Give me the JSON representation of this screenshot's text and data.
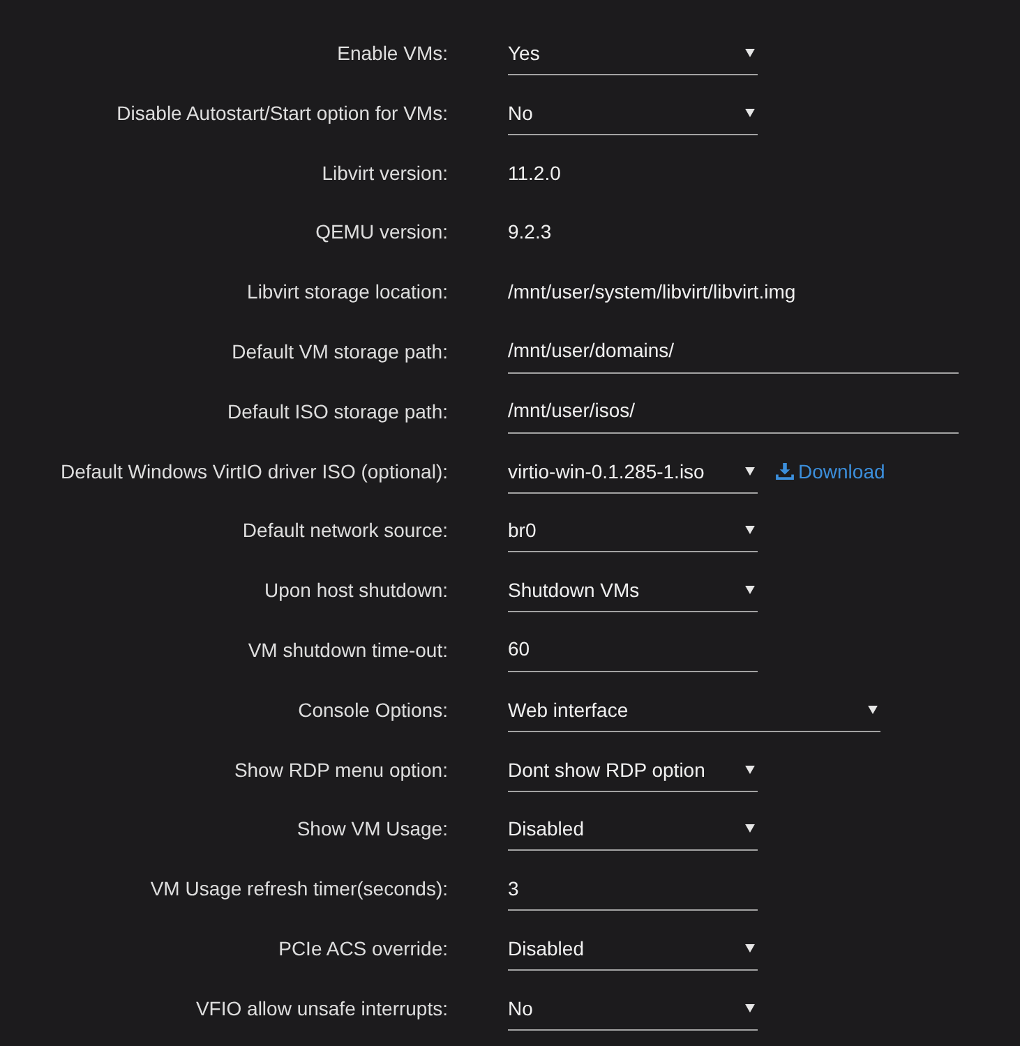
{
  "settings": [
    {
      "label": "Enable VMs:",
      "kind": "select",
      "value": "Yes"
    },
    {
      "label": "Disable Autostart/Start option for VMs:",
      "kind": "select",
      "value": "No"
    },
    {
      "label": "Libvirt version:",
      "kind": "text",
      "value": "11.2.0"
    },
    {
      "label": "QEMU version:",
      "kind": "text",
      "value": "9.2.3"
    },
    {
      "label": "Libvirt storage location:",
      "kind": "text",
      "value": "/mnt/user/system/libvirt/libvirt.img"
    },
    {
      "label": "Default VM storage path:",
      "kind": "wideinput",
      "value": "/mnt/user/domains/"
    },
    {
      "label": "Default ISO storage path:",
      "kind": "wideinput",
      "value": "/mnt/user/isos/"
    },
    {
      "label": "Default Windows VirtIO driver ISO (optional):",
      "kind": "select",
      "value": "virtio-win-0.1.285-1.iso",
      "link": {
        "label": "Download"
      }
    },
    {
      "label": "Default network source:",
      "kind": "select",
      "value": "br0"
    },
    {
      "label": "Upon host shutdown:",
      "kind": "select",
      "value": "Shutdown VMs"
    },
    {
      "label": "VM shutdown time-out:",
      "kind": "input",
      "value": "60"
    },
    {
      "label": "Console Options:",
      "kind": "wideselect",
      "value": "Web interface"
    },
    {
      "label": "Show RDP menu option:",
      "kind": "select",
      "value": "Dont show RDP option"
    },
    {
      "label": "Show VM Usage:",
      "kind": "select",
      "value": "Disabled"
    },
    {
      "label": "VM Usage refresh timer(seconds):",
      "kind": "input",
      "value": "3"
    },
    {
      "label": "PCIe ACS override:",
      "kind": "select",
      "value": "Disabled"
    },
    {
      "label": "VFIO allow unsafe interrupts:",
      "kind": "select",
      "value": "No"
    }
  ]
}
